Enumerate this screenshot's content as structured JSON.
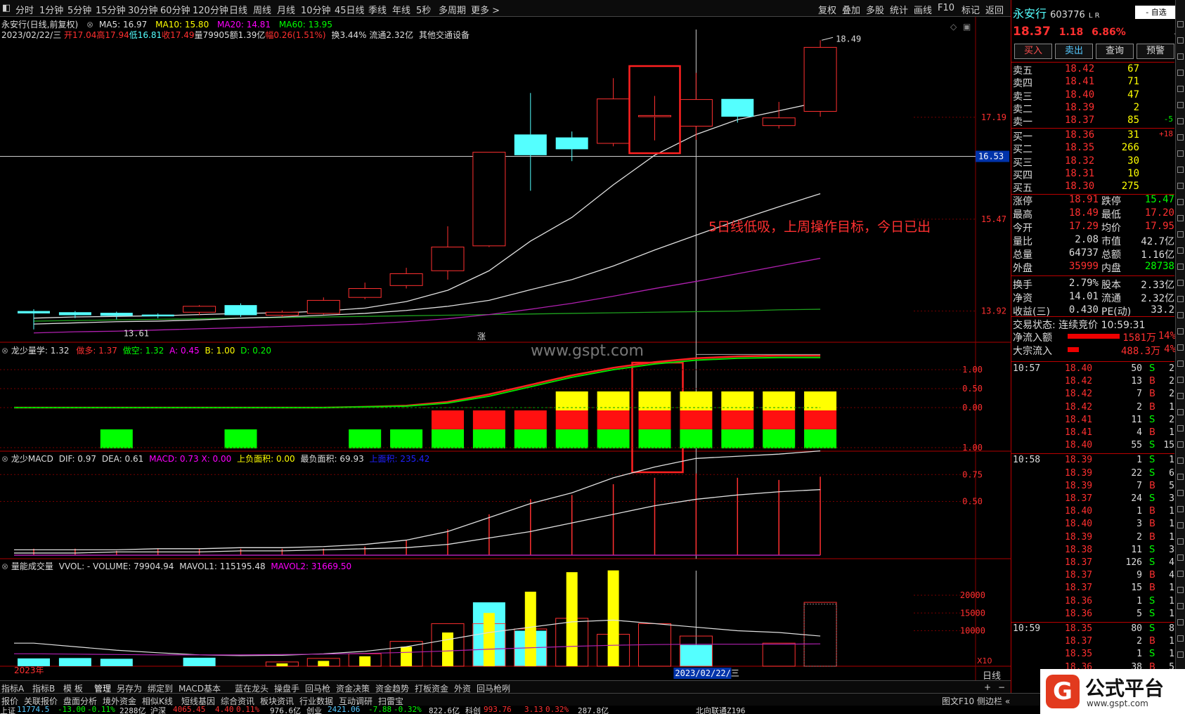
{
  "toolbar": {
    "periods": [
      "分时",
      "1分钟",
      "5分钟",
      "15分钟",
      "30分钟",
      "60分钟",
      "120分钟",
      "日线",
      "周线",
      "月线",
      "10分钟",
      "45日线",
      "季线",
      "年线",
      "5秒",
      "多周期",
      "更多 >"
    ],
    "right": [
      "复权",
      "叠加",
      "多股",
      "统计",
      "画线",
      "F10",
      "标记",
      "返回"
    ]
  },
  "chart": {
    "title_line": "永安行(日线,前复权)",
    "ma5": "MA5: 16.97",
    "ma10": "MA10: 15.80",
    "ma20": "MA20: 14.81",
    "ma60": "MA60: 13.95",
    "info_date": "2023/02/22/三",
    "info_open": "开17.04",
    "info_high": "高17.94",
    "info_low": "低16.81",
    "info_close": "收17.49",
    "info_vol": "量79905",
    "info_amt": "额1.39亿",
    "info_chg": "幅0.26(1.51%)",
    "info_turn": "换3.44%",
    "info_float": "流通2.32亿",
    "info_industry": "其他交通设备",
    "price_labels": [
      "17.19",
      "15.47",
      "13.92"
    ],
    "crosshair_price": "16.53",
    "high_mark": "18.49",
    "low_mark": "13.61",
    "zhang": "涨",
    "annotation": "5日线低吸，上周操作目标，今日已出",
    "watermark": "www.gspt.com",
    "year_label": "2023年",
    "date_label": "2023/02/22/三",
    "x10": "X10",
    "period_label": "日线"
  },
  "panel2": {
    "name": "龙少量学",
    "value": ": 1.32",
    "do_duo": "做多: 1.37",
    "do_kong": "做空: 1.32",
    "a": "A: 0.45",
    "b": "B: 1.00",
    "d": "D: 0.20",
    "ticks": [
      "1.00",
      "0.50",
      "0.00"
    ]
  },
  "panel3": {
    "name": "龙少MACD",
    "dif": "DIF: 0.97",
    "dea": "DEA: 0.61",
    "macd": "MACD: 0.73",
    "x": "X: 0.00",
    "upneg": "上负面积: 0.00",
    "minarea": "最负面积: 69.93",
    "uparea": "上面积: 235.42",
    "ticks": [
      "1.00",
      "0.75",
      "0.50"
    ]
  },
  "panel4": {
    "name": "量能成交量",
    "vvol": "VVOL: - VOLUME: 79904.94",
    "mavol1": "MAVOL1: 115195.48",
    "mavol2": "MAVOL2: 31669.50",
    "ticks": [
      "20000",
      "15000",
      "10000"
    ]
  },
  "quote": {
    "name": "永安行",
    "code": "603776",
    "flags": "L R",
    "tag": "- 自选",
    "price": "18.37",
    "change": "1.18",
    "pct": "6.86%",
    "buttons": [
      "买入",
      "卖出",
      "查询",
      "预警"
    ],
    "asks": [
      {
        "label": "卖五",
        "price": "18.42",
        "vol": "67",
        "extra": ""
      },
      {
        "label": "卖四",
        "price": "18.41",
        "vol": "71",
        "extra": ""
      },
      {
        "label": "卖三",
        "price": "18.40",
        "vol": "47",
        "extra": ""
      },
      {
        "label": "卖二",
        "price": "18.39",
        "vol": "2",
        "extra": ""
      },
      {
        "label": "卖一",
        "price": "18.37",
        "vol": "85",
        "extra": "-5"
      }
    ],
    "bids": [
      {
        "label": "买一",
        "price": "18.36",
        "vol": "31",
        "extra": "+18"
      },
      {
        "label": "买二",
        "price": "18.35",
        "vol": "266",
        "extra": ""
      },
      {
        "label": "买三",
        "price": "18.32",
        "vol": "30",
        "extra": ""
      },
      {
        "label": "买四",
        "price": "18.31",
        "vol": "10",
        "extra": ""
      },
      {
        "label": "买五",
        "price": "18.30",
        "vol": "275",
        "extra": ""
      }
    ],
    "stats": [
      {
        "l1": "涨停",
        "v1": "18.91",
        "l2": "跌停",
        "v2": "15.47"
      },
      {
        "l1": "最高",
        "v1": "18.49",
        "l2": "最低",
        "v2": "17.20"
      },
      {
        "l1": "今开",
        "v1": "17.29",
        "l2": "均价",
        "v2": "17.95"
      },
      {
        "l1": "量比",
        "v1": "2.08",
        "l2": "市值",
        "v2": "42.7亿"
      },
      {
        "l1": "总量",
        "v1": "64737",
        "l2": "总额",
        "v2": "1.16亿"
      },
      {
        "l1": "外盘",
        "v1": "35999",
        "l2": "内盘",
        "v2": "28738"
      },
      {
        "l1": "换手",
        "v1": "2.79%",
        "l2": "股本",
        "v2": "2.33亿"
      },
      {
        "l1": "净资",
        "v1": "14.01",
        "l2": "流通",
        "v2": "2.32亿"
      },
      {
        "l1": "收益(三)",
        "v1": "0.430",
        "l2": "PE(动)",
        "v2": "33.2"
      }
    ],
    "trade_state": "交易状态: 连续竞价 10:59:31",
    "netflow": {
      "label": "净流入额",
      "val": "1581万",
      "pct": "14%"
    },
    "bigflow": {
      "label": "大宗流入",
      "val": "488.3万",
      "pct": "4%"
    },
    "ticks": [
      {
        "t": "10:57",
        "p": "18.40",
        "v": "50",
        "d": "S",
        "n": "2"
      },
      {
        "t": "",
        "p": "18.42",
        "v": "13",
        "d": "B",
        "n": "2"
      },
      {
        "t": "",
        "p": "18.42",
        "v": "7",
        "d": "B",
        "n": "2"
      },
      {
        "t": "",
        "p": "18.42",
        "v": "2",
        "d": "B",
        "n": "1"
      },
      {
        "t": "",
        "p": "18.41",
        "v": "11",
        "d": "S",
        "n": "2"
      },
      {
        "t": "",
        "p": "18.41",
        "v": "4",
        "d": "B",
        "n": "1"
      },
      {
        "t": "",
        "p": "18.40",
        "v": "55",
        "d": "S",
        "n": "15"
      },
      {
        "t": "10:58",
        "p": "18.39",
        "v": "1",
        "d": "S",
        "n": "1"
      },
      {
        "t": "",
        "p": "18.39",
        "v": "22",
        "d": "S",
        "n": "6"
      },
      {
        "t": "",
        "p": "18.39",
        "v": "7",
        "d": "B",
        "n": "5"
      },
      {
        "t": "",
        "p": "18.37",
        "v": "24",
        "d": "S",
        "n": "3"
      },
      {
        "t": "",
        "p": "18.40",
        "v": "1",
        "d": "B",
        "n": "1"
      },
      {
        "t": "",
        "p": "18.40",
        "v": "3",
        "d": "B",
        "n": "1"
      },
      {
        "t": "",
        "p": "18.39",
        "v": "2",
        "d": "B",
        "n": "1"
      },
      {
        "t": "",
        "p": "18.38",
        "v": "11",
        "d": "S",
        "n": "3"
      },
      {
        "t": "",
        "p": "18.37",
        "v": "126",
        "d": "S",
        "n": "4"
      },
      {
        "t": "",
        "p": "18.37",
        "v": "9",
        "d": "B",
        "n": "4"
      },
      {
        "t": "",
        "p": "18.37",
        "v": "15",
        "d": "B",
        "n": "1"
      },
      {
        "t": "",
        "p": "18.36",
        "v": "1",
        "d": "S",
        "n": "1"
      },
      {
        "t": "",
        "p": "18.36",
        "v": "5",
        "d": "S",
        "n": "1"
      },
      {
        "t": "10:59",
        "p": "18.35",
        "v": "80",
        "d": "S",
        "n": "8"
      },
      {
        "t": "",
        "p": "18.37",
        "v": "2",
        "d": "B",
        "n": "1"
      },
      {
        "t": "",
        "p": "18.35",
        "v": "1",
        "d": "S",
        "n": "1"
      },
      {
        "t": "",
        "p": "18.36",
        "v": "38",
        "d": "B",
        "n": "5"
      }
    ]
  },
  "bottom_tabs": [
    "指标A",
    "指标B",
    "模 板",
    "管理",
    "另存为",
    "绑定到",
    "MACD基本",
    "蓝在龙头",
    "操盘手",
    "回马枪",
    "资金决策",
    "资金趋势",
    "打板资金",
    "外资",
    "回马枪咧"
  ],
  "bottom_nav": [
    "报价",
    "关联报价",
    "盘面分析",
    "境外资金",
    "相似K线",
    "短线基因",
    "综合资讯",
    "板块资讯",
    "行业数据",
    "互动调研",
    "扫雷宝"
  ],
  "bottom_right": [
    "图文F10",
    "侧边栏 «"
  ],
  "index_bar": {
    "sh": "上证",
    "sh_val": "11774.5",
    "sh_chg": "-13.00",
    "sh_pct": "-0.11%",
    "sh_amt": "2288亿",
    "sz": "沪深",
    "sz_val": "4065.45",
    "sz_chg": "4.40",
    "sz_pct": "0.11%",
    "sz_amt": "976.6亿",
    "cy": "创业",
    "cy_val": "2421.06",
    "cy_chg": "-7.88",
    "cy_pct": "-0.32%",
    "cy_amt": "822.6亿",
    "kc": "科创",
    "kc_val": "993.76",
    "kc_chg": "3.13",
    "kc_pct": "0.32%",
    "kc_amt": "287.8亿",
    "bj": "北向联通Z196"
  },
  "logo": {
    "text": "公式平台",
    "url": "www.gspt.com"
  },
  "colors": {
    "up": "#ff3030",
    "down": "#54ffff",
    "yellow": "#ffff00",
    "green": "#00ff00",
    "magenta": "#ff00ff",
    "blue": "#2020ff"
  },
  "chart_data": {
    "type": "candlestick",
    "candles": [
      {
        "o": 13.92,
        "c": 13.88,
        "h": 13.95,
        "l": 13.61
      },
      {
        "o": 13.9,
        "c": 13.85,
        "h": 13.92,
        "l": 13.8
      },
      {
        "o": 13.89,
        "c": 13.84,
        "h": 13.91,
        "l": 13.78
      },
      {
        "o": 13.86,
        "c": 13.83,
        "h": 13.88,
        "l": 13.8
      },
      {
        "o": 13.9,
        "c": 14.0,
        "h": 14.02,
        "l": 13.85
      },
      {
        "o": 14.02,
        "c": 13.85,
        "h": 14.05,
        "l": 13.82
      },
      {
        "o": 13.85,
        "c": 13.9,
        "h": 13.93,
        "l": 13.82
      },
      {
        "o": 13.88,
        "c": 14.1,
        "h": 14.15,
        "l": 13.86
      },
      {
        "o": 14.15,
        "c": 14.3,
        "h": 14.4,
        "l": 14.12
      },
      {
        "o": 14.35,
        "c": 14.55,
        "h": 14.65,
        "l": 14.3
      },
      {
        "o": 14.6,
        "c": 15.0,
        "h": 15.35,
        "l": 14.45
      },
      {
        "o": 15.02,
        "c": 16.6,
        "h": 16.6,
        "l": 15.0
      },
      {
        "o": 16.9,
        "c": 16.55,
        "h": 17.6,
        "l": 15.95
      },
      {
        "o": 16.85,
        "c": 16.65,
        "h": 16.95,
        "l": 16.45
      },
      {
        "o": 16.75,
        "c": 17.5,
        "h": 17.85,
        "l": 16.7
      },
      {
        "o": 17.2,
        "c": 17.22,
        "h": 17.55,
        "l": 16.8
      },
      {
        "o": 17.04,
        "c": 17.49,
        "h": 17.94,
        "l": 16.81
      },
      {
        "o": 17.5,
        "c": 17.2,
        "h": 17.5,
        "l": 17.1
      },
      {
        "o": 17.05,
        "c": 17.18,
        "h": 17.45,
        "l": 17.0
      },
      {
        "o": 17.29,
        "c": 18.37,
        "h": 18.49,
        "l": 17.2
      }
    ],
    "ma5": [
      13.8,
      13.82,
      13.83,
      13.84,
      13.86,
      13.88,
      13.89,
      13.92,
      13.97,
      14.08,
      14.27,
      14.6,
      15.1,
      15.5,
      16.05,
      16.55,
      16.9,
      17.15,
      17.3,
      17.45
    ],
    "ma10": [
      13.7,
      13.72,
      13.74,
      13.75,
      13.77,
      13.8,
      13.82,
      13.85,
      13.88,
      13.93,
      14.0,
      14.1,
      14.28,
      14.45,
      14.68,
      14.95,
      15.2,
      15.45,
      15.68,
      15.9
    ],
    "ma20": [
      13.55,
      13.57,
      13.58,
      13.6,
      13.62,
      13.64,
      13.66,
      13.68,
      13.7,
      13.74,
      13.79,
      13.86,
      13.95,
      14.05,
      14.17,
      14.3,
      14.42,
      14.55,
      14.68,
      14.81
    ],
    "ma60": [
      13.75,
      13.76,
      13.77,
      13.78,
      13.79,
      13.8,
      13.81,
      13.82,
      13.83,
      13.84,
      13.85,
      13.86,
      13.87,
      13.88,
      13.89,
      13.9,
      13.91,
      13.92,
      13.94,
      13.95
    ],
    "lsl_line1": [
      0.0,
      0.0,
      0.0,
      0.0,
      0.0,
      0.0,
      0.0,
      0.0,
      0.02,
      0.05,
      0.15,
      0.35,
      0.6,
      0.85,
      1.05,
      1.2,
      1.3,
      1.35,
      1.37,
      1.37
    ],
    "lsl_line2": [
      0.0,
      0.0,
      0.0,
      0.0,
      0.0,
      0.0,
      0.0,
      0.0,
      0.02,
      0.04,
      0.12,
      0.3,
      0.55,
      0.8,
      1.0,
      1.15,
      1.25,
      1.3,
      1.32,
      1.32
    ],
    "lsl_bars": [
      0,
      0,
      1,
      0,
      0,
      1,
      0,
      0,
      1,
      1,
      2,
      2,
      2,
      3,
      3,
      3,
      3,
      3,
      3,
      3
    ],
    "macd_dif": [
      0.05,
      0.05,
      0.05,
      0.06,
      0.06,
      0.07,
      0.07,
      0.08,
      0.1,
      0.14,
      0.22,
      0.35,
      0.48,
      0.58,
      0.72,
      0.82,
      0.9,
      0.92,
      0.94,
      0.97
    ],
    "macd_dea": [
      0.02,
      0.02,
      0.03,
      0.03,
      0.03,
      0.04,
      0.04,
      0.05,
      0.06,
      0.07,
      0.1,
      0.16,
      0.22,
      0.3,
      0.38,
      0.46,
      0.52,
      0.56,
      0.59,
      0.61
    ],
    "macd_bar": [
      0.06,
      0.06,
      0.04,
      0.06,
      0.06,
      0.06,
      0.06,
      0.06,
      0.08,
      0.14,
      0.24,
      0.38,
      0.52,
      0.56,
      0.66,
      0.72,
      0.76,
      0.72,
      0.7,
      0.73
    ],
    "vol_up": [
      0,
      0,
      0,
      0,
      0,
      0,
      1200,
      2200,
      3500,
      7000,
      12000,
      12000,
      10500,
      13500,
      9000,
      12000,
      8500,
      0,
      6500,
      18000
    ],
    "vol_yellow": [
      0,
      0,
      0,
      0,
      0,
      0,
      800,
      1500,
      2800,
      5500,
      9500,
      15000,
      21000,
      26500,
      27000,
      0,
      0,
      0,
      0,
      0
    ],
    "vol_cyan": [
      2200,
      2300,
      2100,
      0,
      2400,
      0,
      0,
      0,
      0,
      0,
      0,
      18000,
      10000,
      0,
      0,
      0,
      6000,
      0,
      0,
      0
    ],
    "mavol1": [
      6500,
      5500,
      4500,
      3800,
      3200,
      3000,
      3100,
      3500,
      4200,
      5500,
      7500,
      9500,
      11000,
      12500,
      13000,
      12000,
      11000,
      10000,
      9500,
      8500
    ],
    "mavol2": [
      3500,
      3400,
      3300,
      3200,
      3200,
      3200,
      3300,
      3400,
      3600,
      3900,
      4300,
      4800,
      5200,
      5600,
      5900,
      6100,
      6200,
      6200,
      6200,
      6300
    ]
  }
}
